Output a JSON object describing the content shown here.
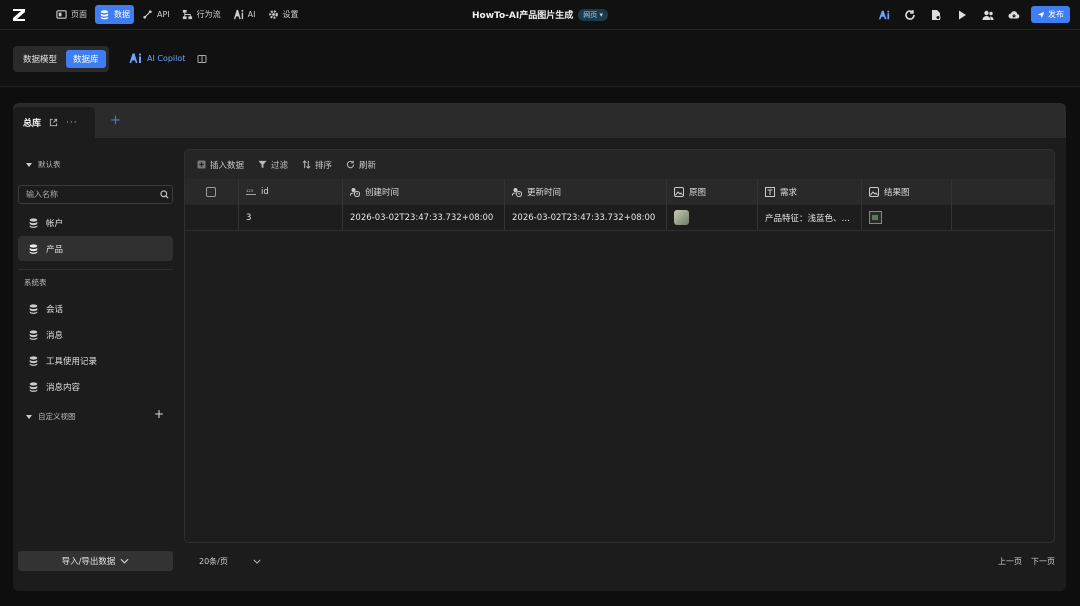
{
  "topbar": {
    "nav": [
      {
        "key": "page",
        "label": "页面",
        "icon": "page-icon"
      },
      {
        "key": "data",
        "label": "数据",
        "icon": "database-icon",
        "active": true
      },
      {
        "key": "api",
        "label": "API",
        "icon": "api-icon"
      },
      {
        "key": "flow",
        "label": "行为流",
        "icon": "flow-icon"
      },
      {
        "key": "ai",
        "label": "AI",
        "icon": "ai-icon"
      },
      {
        "key": "settings",
        "label": "设置",
        "icon": "gear-icon"
      }
    ],
    "app_title": "HowTo-AI产品图片生成",
    "app_badge": "网页 ▾",
    "publish_label": "发布"
  },
  "subheader": {
    "seg_model": "数据模型",
    "seg_db": "数据库",
    "copilot_label": "AI Copilot"
  },
  "panel": {
    "tab_label": "总库",
    "tab_more": "···",
    "add_tab": "+"
  },
  "sidebar": {
    "default_group": "默认表",
    "search_placeholder": "输入名称",
    "default_tables": [
      "帐户",
      "产品"
    ],
    "system_group": "系统表",
    "system_tables": [
      "会话",
      "消息",
      "工具使用记录",
      "消息内容"
    ],
    "custom_group": "自定义视图",
    "custom_add": "+",
    "import_label": "导入/导出数据"
  },
  "toolbar": {
    "insert": "插入数据",
    "filter": "过滤",
    "sort": "排序",
    "refresh": "刷新"
  },
  "table": {
    "columns": [
      {
        "key": "id",
        "label": "id",
        "icon": "number-icon"
      },
      {
        "key": "created",
        "label": "创建时间",
        "icon": "clock-user-icon"
      },
      {
        "key": "updated",
        "label": "更新时间",
        "icon": "clock-user-icon"
      },
      {
        "key": "src_img",
        "label": "原图",
        "icon": "image-icon"
      },
      {
        "key": "need",
        "label": "需求",
        "icon": "text-icon"
      },
      {
        "key": "result_img",
        "label": "结果图",
        "icon": "image-icon"
      }
    ],
    "rows": [
      {
        "id": "3",
        "created": "2026-03-02T23:47:33.732+08:00",
        "updated": "2026-03-02T23:47:33.732+08:00",
        "need": "产品特征：浅蓝色、…"
      }
    ]
  },
  "pager": {
    "page_size": "20条/页",
    "prev": "上一页",
    "next": "下一页"
  },
  "colors": {
    "accent": "#3f7ef2",
    "bg": "#0e0e0f",
    "panel": "#1c1c1d"
  }
}
